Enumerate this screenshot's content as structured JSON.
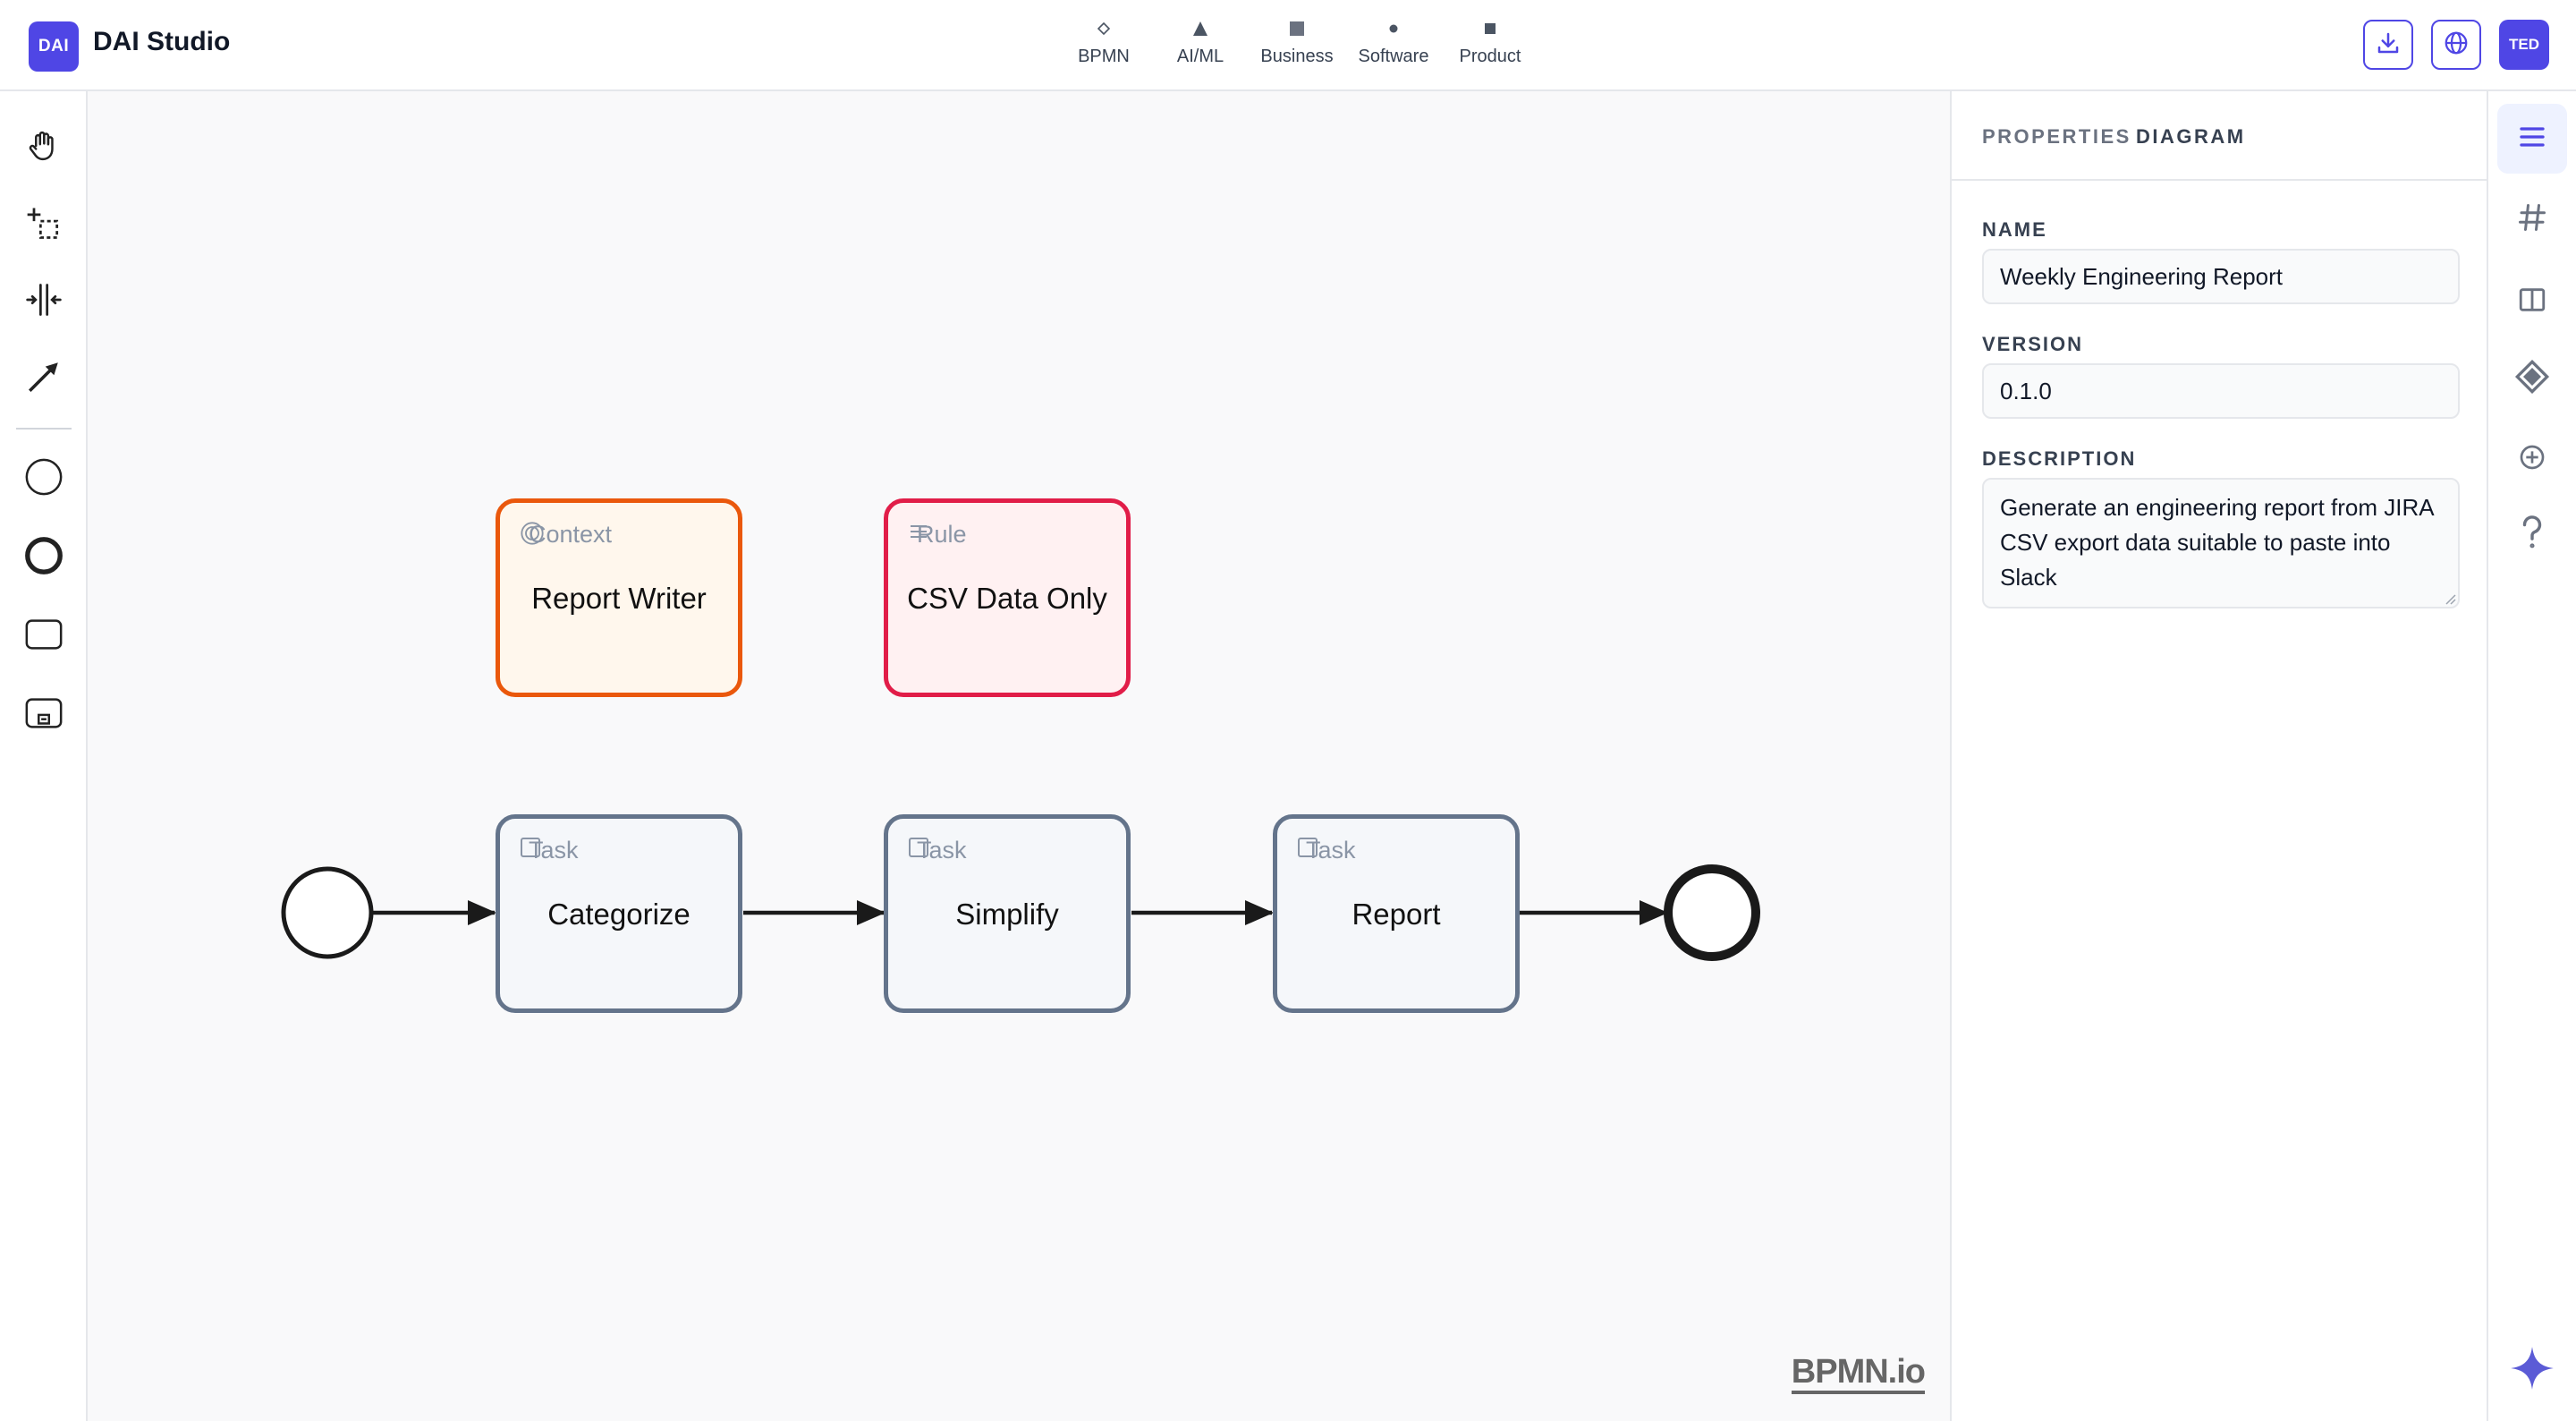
{
  "app": {
    "badge": "DAI",
    "title": "DAI Studio"
  },
  "categories": [
    {
      "label": "BPMN",
      "icon": "diamond-icon"
    },
    {
      "label": "AI/ML",
      "icon": "triangle-icon"
    },
    {
      "label": "Business",
      "icon": "square-icon"
    },
    {
      "label": "Software",
      "icon": "dot-icon"
    },
    {
      "label": "Product",
      "icon": "small-square-icon"
    }
  ],
  "user": {
    "initials": "TED"
  },
  "toolbar": [
    "hand-tool-icon",
    "lasso-tool-icon",
    "space-tool-icon",
    "connect-tool-icon",
    "start-event-icon",
    "end-event-icon",
    "task-icon",
    "subprocess-icon"
  ],
  "diagram": {
    "context": {
      "type": "Context",
      "label": "Report Writer"
    },
    "rule": {
      "type": "Rule",
      "label": "CSV Data Only"
    },
    "tasks": [
      {
        "type": "Task",
        "label": "Categorize"
      },
      {
        "type": "Task",
        "label": "Simplify"
      },
      {
        "type": "Task",
        "label": "Report"
      }
    ],
    "watermark": "BPMN.io"
  },
  "properties": {
    "tab_primary": "PROPERTIES",
    "tab_secondary": "DIAGRAM",
    "name_label": "NAME",
    "name_value": "Weekly Engineering Report",
    "version_label": "VERSION",
    "version_value": "0.1.0",
    "description_label": "DESCRIPTION",
    "description_value": "Generate an engineering report from JIRA CSV export data suitable to paste into Slack"
  },
  "rail": [
    "menu-icon",
    "hash-icon",
    "columns-icon",
    "diamond-layer-icon",
    "plus-circle-icon",
    "help-icon",
    "sparkle-icon"
  ],
  "colors": {
    "accent": "#4f46e5",
    "context": "#ea580c",
    "rule": "#e11d48",
    "task": "#64748b"
  }
}
